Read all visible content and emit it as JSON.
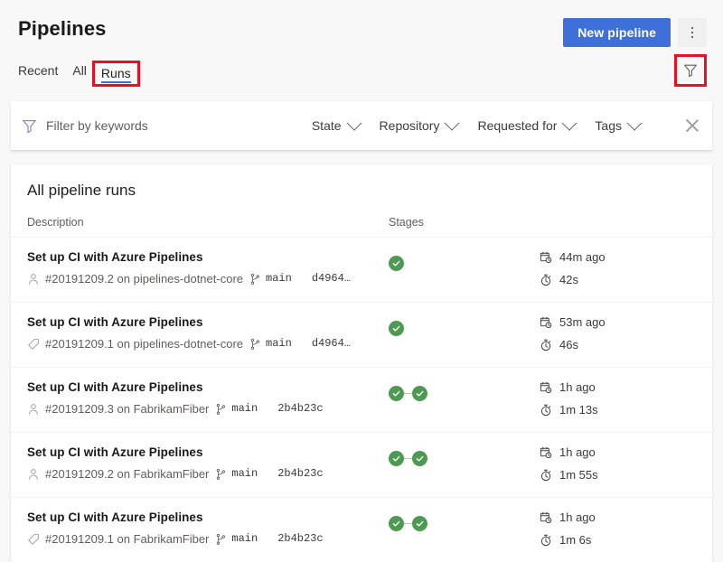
{
  "header": {
    "title": "Pipelines",
    "new_pipeline_label": "New pipeline",
    "more_actions_icon": "vertical-ellipsis-icon"
  },
  "tabs": [
    {
      "label": "Recent",
      "selected": false
    },
    {
      "label": "All",
      "selected": false
    },
    {
      "label": "Runs",
      "selected": true,
      "annotated": true
    }
  ],
  "filter_toggle": {
    "icon": "filter-funnel-icon",
    "annotated": true
  },
  "filter_bar": {
    "keyword_icon": "filter-funnel-icon",
    "keyword_placeholder": "Filter by keywords",
    "keyword_value": "",
    "dropdowns": [
      {
        "label": "State"
      },
      {
        "label": "Repository"
      },
      {
        "label": "Requested for"
      },
      {
        "label": "Tags"
      }
    ],
    "clear_icon": "close-icon"
  },
  "runs_card": {
    "title": "All pipeline runs",
    "columns": {
      "description": "Description",
      "stages": "Stages"
    },
    "rows": [
      {
        "name": "Set up CI with Azure Pipelines",
        "trigger_icon": "person-icon",
        "meta": "#20191209.2 on pipelines-dotnet-core",
        "branch_icon": "branch-icon",
        "branch": "main",
        "commit": "d4964…",
        "stages": [
          "succeeded"
        ],
        "time_ago_icon": "calendar-clock-icon",
        "time_ago": "44m ago",
        "duration_icon": "stopwatch-icon",
        "duration": "42s"
      },
      {
        "name": "Set up CI with Azure Pipelines",
        "trigger_icon": "tag-icon",
        "meta": "#20191209.1 on pipelines-dotnet-core",
        "branch_icon": "branch-icon",
        "branch": "main",
        "commit": "d4964…",
        "stages": [
          "succeeded"
        ],
        "time_ago_icon": "calendar-clock-icon",
        "time_ago": "53m ago",
        "duration_icon": "stopwatch-icon",
        "duration": "46s"
      },
      {
        "name": "Set up CI with Azure Pipelines",
        "trigger_icon": "person-icon",
        "meta": "#20191209.3 on FabrikamFiber",
        "branch_icon": "branch-icon",
        "branch": "main",
        "commit": "2b4b23c",
        "stages": [
          "succeeded",
          "succeeded"
        ],
        "time_ago_icon": "calendar-clock-icon",
        "time_ago": "1h ago",
        "duration_icon": "stopwatch-icon",
        "duration": "1m 13s"
      },
      {
        "name": "Set up CI with Azure Pipelines",
        "trigger_icon": "person-icon",
        "meta": "#20191209.2 on FabrikamFiber",
        "branch_icon": "branch-icon",
        "branch": "main",
        "commit": "2b4b23c",
        "stages": [
          "succeeded",
          "succeeded"
        ],
        "time_ago_icon": "calendar-clock-icon",
        "time_ago": "1h ago",
        "duration_icon": "stopwatch-icon",
        "duration": "1m 55s"
      },
      {
        "name": "Set up CI with Azure Pipelines",
        "trigger_icon": "tag-icon",
        "meta": "#20191209.1 on FabrikamFiber",
        "branch_icon": "branch-icon",
        "branch": "main",
        "commit": "2b4b23c",
        "stages": [
          "succeeded",
          "succeeded"
        ],
        "time_ago_icon": "calendar-clock-icon",
        "time_ago": "1h ago",
        "duration_icon": "stopwatch-icon",
        "duration": "1m 6s"
      }
    ]
  },
  "colors": {
    "accent_blue": "#3f6fd8",
    "success_green": "#4f9a52",
    "annotation_red": "#e81123",
    "page_background": "#f8f8f8"
  }
}
